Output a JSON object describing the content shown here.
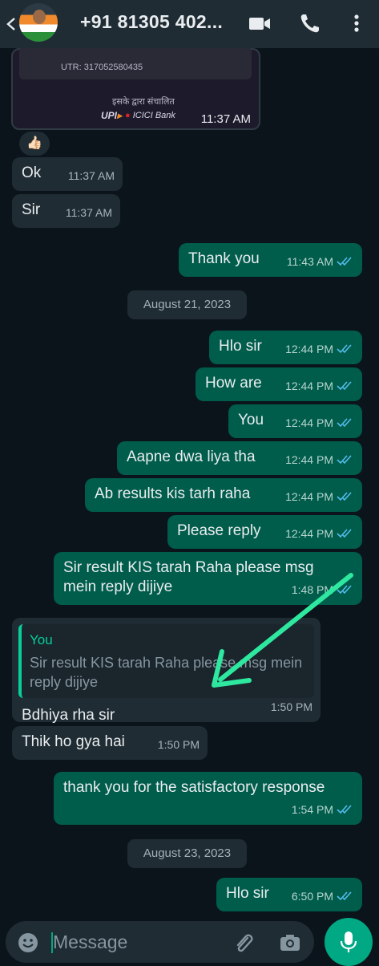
{
  "header": {
    "contact_name": "+91 81305 402...",
    "icons": [
      "video-call-icon",
      "voice-call-icon",
      "more-options-icon"
    ]
  },
  "receipt": {
    "utr": "UTR: 317052580435",
    "powered_by": "इसके द्वारा संचालित",
    "upi_logo": "UPI",
    "bank_logo": "ICICI Bank",
    "time": "11:37 AM"
  },
  "reaction": "👍🏻",
  "messages": [
    {
      "text": "Ok",
      "time": "11:37 AM"
    },
    {
      "text": "Sir",
      "time": "11:37 AM"
    },
    {
      "text": "Thank you",
      "time": "11:43 AM"
    },
    {
      "text": "Hlo sir",
      "time": "12:44 PM"
    },
    {
      "text": "How are",
      "time": "12:44 PM"
    },
    {
      "text": "You",
      "time": "12:44 PM"
    },
    {
      "text": "Aapne dwa liya tha",
      "time": "12:44 PM"
    },
    {
      "text": "Ab results kis tarh raha",
      "time": "12:44 PM"
    },
    {
      "text": "Please reply",
      "time": "12:44 PM"
    },
    {
      "text": "Sir result KIS tarah Raha please msg mein reply dijiye",
      "time": "1:48 PM"
    },
    {
      "text": "Bdhiya rha sir",
      "time": "1:50 PM",
      "quote_author": "You",
      "quote_text": "Sir result KIS tarah Raha please msg mein reply dijiye"
    },
    {
      "text": "Thik ho gya hai",
      "time": "1:50 PM"
    },
    {
      "text": "thank you for the satisfactory response",
      "time": "1:54 PM"
    },
    {
      "text": "Hlo sir",
      "time": "6:50 PM"
    }
  ],
  "dates": [
    "August 21, 2023",
    "August 23, 2023"
  ],
  "composer": {
    "placeholder": "Message",
    "icons": [
      "emoji-icon",
      "attach-icon",
      "camera-icon",
      "mic-icon"
    ]
  },
  "colors": {
    "background": "#0b141a",
    "header": "#1f2c34",
    "incoming_bubble": "#202c33",
    "outgoing_bubble": "#005c4b",
    "accent": "#00a884",
    "read_ticks": "#53bdeb",
    "annotation_arrow": "#2ee8a0"
  }
}
